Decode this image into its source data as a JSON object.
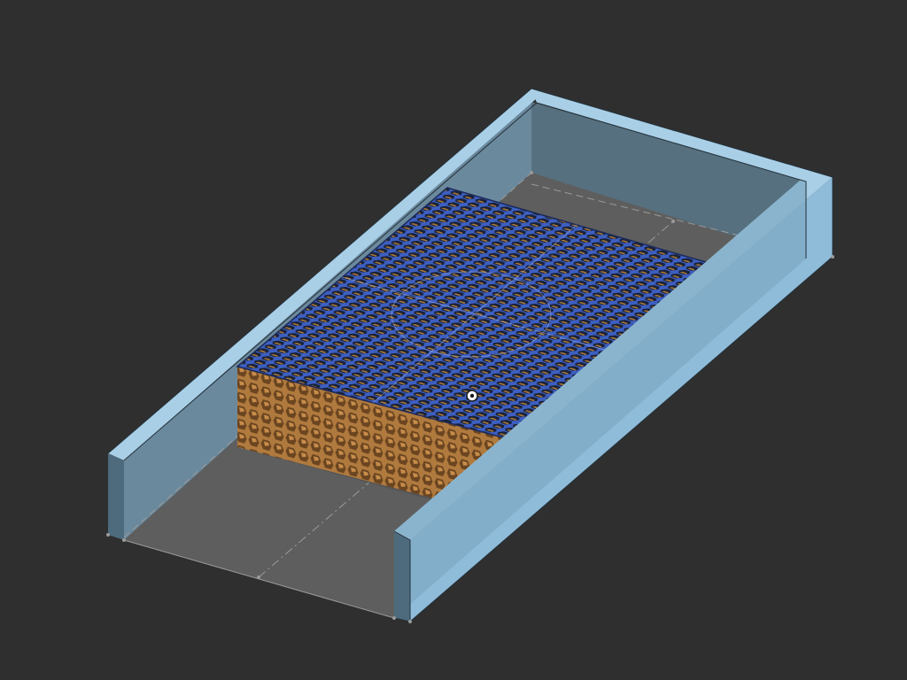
{
  "view": {
    "mode": "3d-cad-viewport",
    "projection": "isometric"
  },
  "colors": {
    "background": "#2f2f2f",
    "tray_top": "#a9cfe7",
    "tray_face_light": "#8fbcd9",
    "tray_face_dark": "#4e6b7e",
    "tray_inner_wall": "#56707f",
    "tray_floor": "#5e5e5e",
    "block_top": "#3d5fc2",
    "block_top_holes": "#1a2238",
    "block_side": "#b07a3e",
    "block_side_holes": "#6b4520",
    "sketch_lines": "#9a9a9a",
    "edge": "#24313a"
  },
  "model": {
    "parts": [
      {
        "name": "tray",
        "shape": "u-channel"
      },
      {
        "name": "lattice-block",
        "shape": "honeycomb-grid"
      }
    ]
  }
}
